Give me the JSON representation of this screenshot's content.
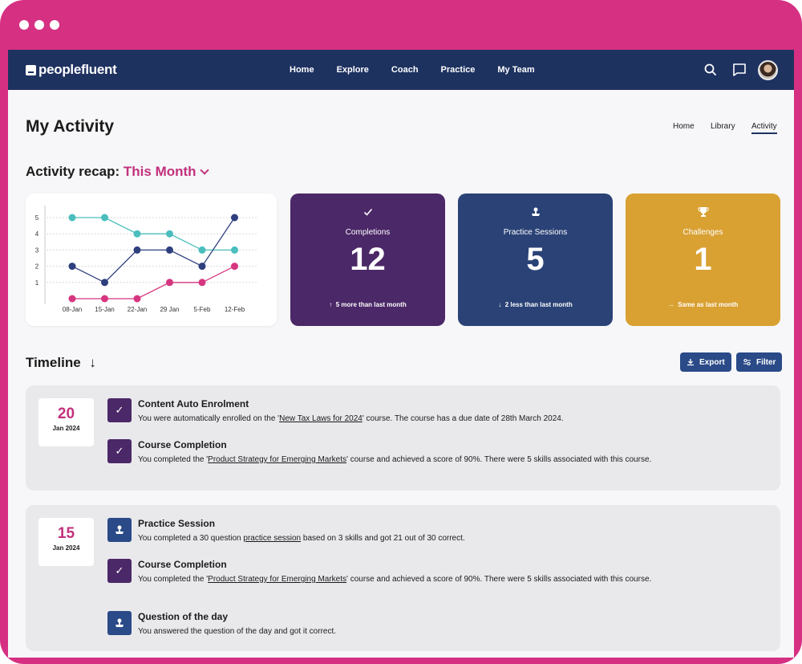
{
  "brand": {
    "name": "peoplefluent"
  },
  "nav": {
    "items": [
      "Home",
      "Explore",
      "Coach",
      "Practice",
      "My Team"
    ]
  },
  "page": {
    "title": "My Activity"
  },
  "subnav": {
    "home": "Home",
    "library": "Library",
    "activity": "Activity"
  },
  "recap": {
    "label": "Activity recap:",
    "period": "This Month"
  },
  "chart_data": {
    "type": "line",
    "x": [
      "08-Jan",
      "15-Jan",
      "22-Jan",
      "29 Jan",
      "5-Feb",
      "12-Feb"
    ],
    "yticks": [
      "1",
      "2",
      "3",
      "4",
      "5"
    ],
    "ylim": [
      0,
      5
    ],
    "grid": true,
    "series": [
      {
        "color": "#4bbdbd",
        "values": [
          5,
          5,
          4,
          4,
          3,
          3
        ]
      },
      {
        "color": "#2e3f7e",
        "values": [
          2,
          1,
          3,
          3,
          2,
          5
        ]
      },
      {
        "color": "#d6367f",
        "values": [
          0,
          0,
          0,
          1,
          1,
          2
        ]
      }
    ]
  },
  "stats": {
    "completions": {
      "label": "Completions",
      "value": "12",
      "note": "5 more than last month",
      "color": "#4b2867"
    },
    "practice": {
      "label": "Practice Sessions",
      "value": "5",
      "note": "2 less than last month",
      "color": "#2a4276"
    },
    "challenges": {
      "label": "Challenges",
      "value": "1",
      "note": "Same as last month",
      "color": "#d9a032"
    }
  },
  "timeline": {
    "title": "Timeline",
    "export_label": "Export",
    "filter_label": "Filter",
    "groups": [
      {
        "day": "20",
        "month_year": "Jan 2024",
        "entries": [
          {
            "title": "Content Auto Enrolment",
            "pre": "You were automatically enrolled on the '",
            "link": "New Tax Laws for 2024",
            "post": "' course. The course has a due date of 28th March 2024."
          },
          {
            "title": "Course Completion",
            "pre": "You completed the '",
            "link": "Product Strategy for Emerging Markets",
            "post": "' course and achieved a score of 90%.  There were 5 skills associated with this course."
          }
        ]
      },
      {
        "day": "15",
        "month_year": "Jan 2024",
        "entries": [
          {
            "title": "Practice Session",
            "pre": "You completed a 30 question ",
            "link": "practice session",
            "post": " based on 3 skills and got 21 out of 30 correct."
          },
          {
            "title": "Course Completion",
            "pre": "You completed the '",
            "link": "Product Strategy for Emerging Markets",
            "post": "' course and achieved a score of 90%.  There were 5 skills associated with this course."
          },
          {
            "title": "Question of the day",
            "pre": "You answered the question of the day and got it correct.",
            "link": "",
            "post": ""
          }
        ]
      }
    ]
  },
  "colors": {
    "navbar": "#1e3260",
    "accent": "#c2317c",
    "purple_icon": "#4b2867",
    "blue_icon": "#2a4a88"
  }
}
